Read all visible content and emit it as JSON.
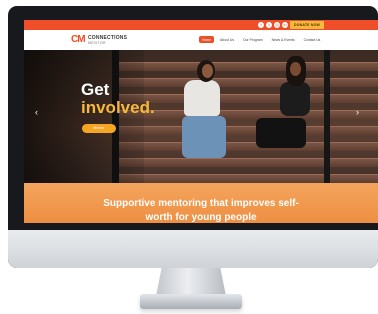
{
  "topbar": {
    "social_icons": [
      "facebook-icon",
      "twitter-icon",
      "instagram-icon",
      "linkedin-icon"
    ],
    "donate_label": "DONATE NOW"
  },
  "brand": {
    "mark": "CM",
    "name": "CONNECTIONS",
    "tagline": "MENTOR"
  },
  "nav": {
    "items": [
      "Home",
      "About Us",
      "Our Program",
      "News & Events",
      "Contact Us"
    ],
    "active_index": 0
  },
  "hero": {
    "headline_line1": "Get",
    "headline_line2": "involved.",
    "button_label": "Mentor",
    "prev_arrow": "‹",
    "next_arrow": "›"
  },
  "banner": {
    "title_line1": "Supportive mentoring that improves self-",
    "title_line2": "worth for young people"
  },
  "colors": {
    "brand_red": "#ef4e28",
    "accent_yellow": "#f6b93b",
    "banner_orange": "#ee8f42"
  }
}
